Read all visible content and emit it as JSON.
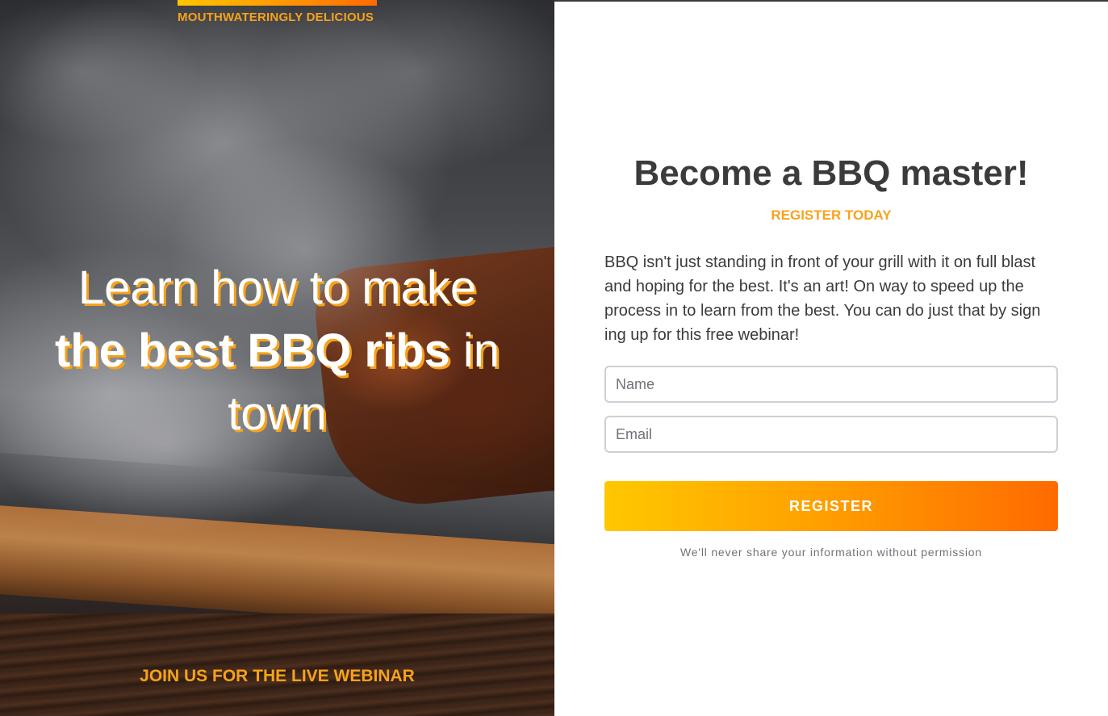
{
  "hero": {
    "eyebrow": "MOUTHWATERINGLY DELICIOUS",
    "headline_line1": "Learn how to make",
    "headline_bold": "the best BBQ ribs",
    "headline_after_bold": " in",
    "headline_line3": "town",
    "footer_cta": "JOIN US FOR THE LIVE WEBINAR",
    "image": "bbq-ribs-smoke-photo"
  },
  "form": {
    "title": "Become a BBQ master!",
    "subtitle": "REGISTER TODAY",
    "body": "BBQ isn't just standing in front of your grill with it on full blast and hoping for the best. It's an art! On way to speed up the process in to learn from the best. You can do just that by sign ing up for this free webinar!",
    "name_placeholder": "Name",
    "email_placeholder": "Email",
    "name_value": "",
    "email_value": "",
    "register_label": "REGISTER",
    "privacy_note": "We'll never share your information without permission"
  },
  "colors": {
    "accent": "#f7a21b",
    "gradient_start": "#ffc800",
    "gradient_end": "#ff6a00",
    "text_dark": "#3b3b3b"
  }
}
